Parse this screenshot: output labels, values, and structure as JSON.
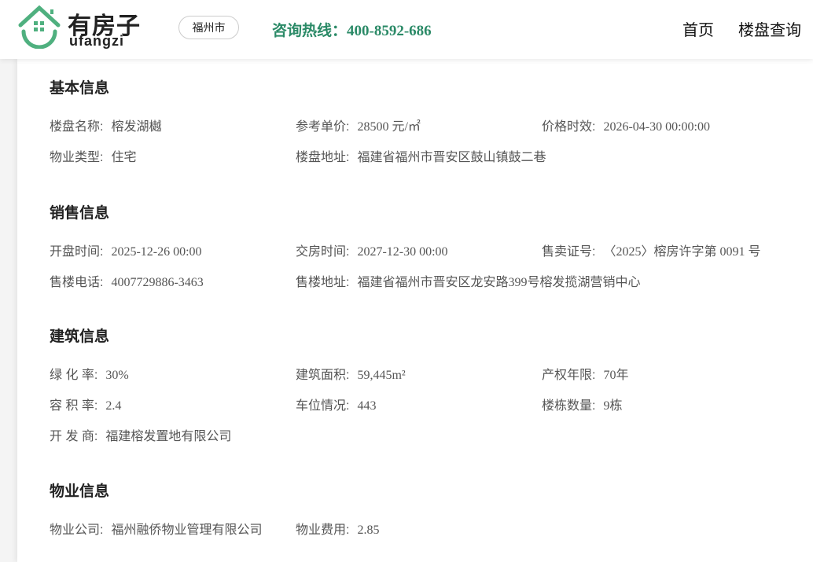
{
  "header": {
    "logo_cn": "有房子",
    "logo_en": "ufangzi",
    "city": "福州市",
    "hotline": "咨询热线：400-8592-686",
    "nav": [
      "首页",
      "楼盘查询"
    ]
  },
  "sections": [
    {
      "title": "基本信息",
      "fields": [
        {
          "label": "楼盘名称:",
          "value": "榕发湖樾"
        },
        {
          "label": "参考单价:",
          "value": "28500 元/㎡"
        },
        {
          "label": "价格时效:",
          "value": "2026-04-30 00:00:00"
        },
        {
          "label": "物业类型:",
          "value": "住宅"
        },
        {
          "label": "楼盘地址:",
          "value": "福建省福州市晋安区鼓山镇鼓二巷"
        }
      ]
    },
    {
      "title": "销售信息",
      "fields": [
        {
          "label": "开盘时间:",
          "value": "2025-12-26 00:00"
        },
        {
          "label": "交房时间:",
          "value": "2027-12-30 00:00"
        },
        {
          "label": "售卖证号:",
          "value": "〈2025〉榕房许字第 0091 号"
        },
        {
          "label": "售楼电话:",
          "value": "4007729886-3463"
        },
        {
          "label": "售楼地址:",
          "value": "福建省福州市晋安区龙安路399号榕发揽湖营销中心"
        }
      ]
    },
    {
      "title": "建筑信息",
      "fields": [
        {
          "label": "绿 化 率:",
          "value": "30%"
        },
        {
          "label": "建筑面积:",
          "value": "59,445m²"
        },
        {
          "label": "产权年限:",
          "value": "70年"
        },
        {
          "label": "容 积 率:",
          "value": "2.4"
        },
        {
          "label": "车位情况:",
          "value": "443"
        },
        {
          "label": "楼栋数量:",
          "value": "9栋"
        },
        {
          "label": "开 发 商:",
          "value": "福建榕发置地有限公司"
        }
      ]
    },
    {
      "title": "物业信息",
      "fields": [
        {
          "label": "物业公司:",
          "value": "福州融侨物业管理有限公司"
        },
        {
          "label": "物业费用:",
          "value": "2.85"
        }
      ]
    }
  ]
}
